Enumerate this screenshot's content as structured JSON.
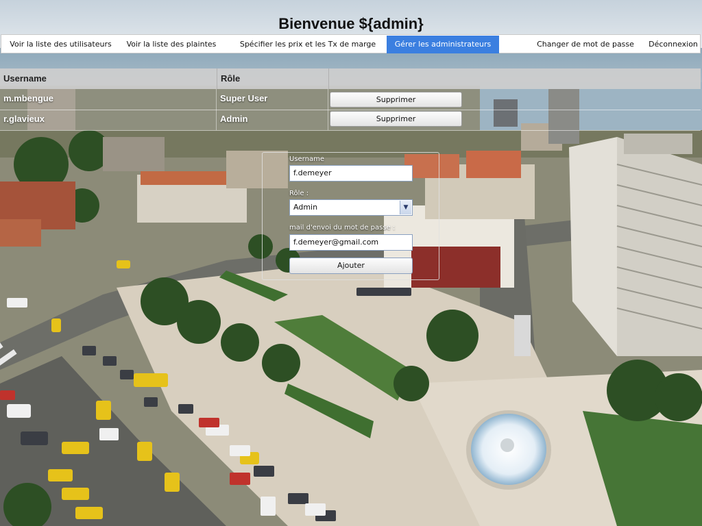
{
  "header": {
    "title": "Bienvenue ${admin}"
  },
  "nav": {
    "items": [
      {
        "label": "Voir la liste des utilisateurs",
        "active": false
      },
      {
        "label": "Voir la liste des plaintes",
        "active": false
      },
      {
        "label": "Spécifier les prix et les Tx de marge",
        "active": false
      },
      {
        "label": "Gérer les administrateurs",
        "active": true
      },
      {
        "label": "Changer de mot de passe",
        "active": false
      },
      {
        "label": "Déconnexion",
        "active": false
      }
    ],
    "active_color": "#3b7fe0"
  },
  "table": {
    "headers": [
      "Username",
      "Rôle"
    ],
    "rows": [
      {
        "username": "m.mbengue",
        "role": "Super User",
        "action": "Supprimer"
      },
      {
        "username": "r.glavieux",
        "role": "Admin",
        "action": "Supprimer"
      }
    ]
  },
  "form": {
    "username_label": "Username",
    "username_value": "f.demeyer",
    "role_label": "Rôle :",
    "role_value": "Admin",
    "email_label": "mail d'envoi du mot de passe :",
    "email_value": "f.demeyer@gmail.com",
    "submit_label": "Ajouter"
  },
  "icons": {
    "select_arrow": "chevron-down-icon"
  }
}
